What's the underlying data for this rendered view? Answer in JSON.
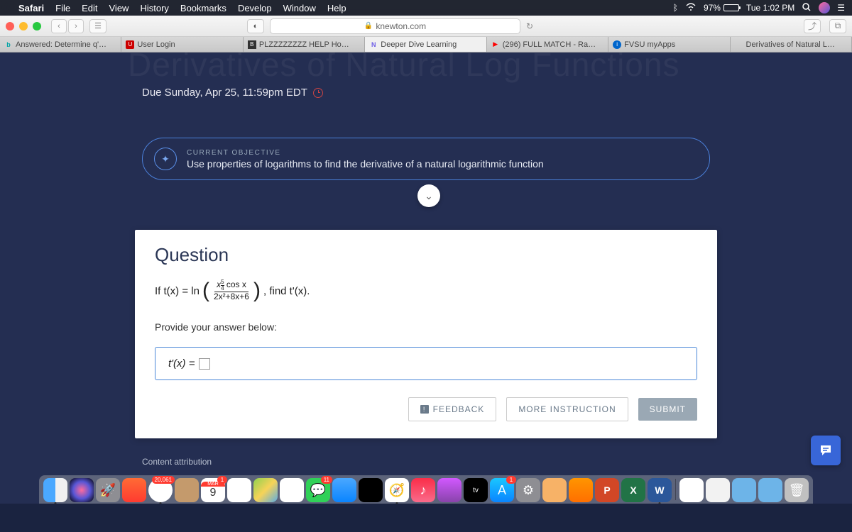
{
  "menubar": {
    "app": "Safari",
    "items": [
      "File",
      "Edit",
      "View",
      "History",
      "Bookmarks",
      "Develop",
      "Window",
      "Help"
    ],
    "battery_pct": "97%",
    "clock": "Tue 1:02 PM"
  },
  "browser": {
    "url_host": "knewton.com"
  },
  "tabs": [
    {
      "label": "Answered: Determine q'…",
      "icon": "b"
    },
    {
      "label": "User Login",
      "icon": "u"
    },
    {
      "label": "PLZZZZZZZZ HELP Ho…",
      "icon": "bb"
    },
    {
      "label": "Deeper Dive Learning",
      "icon": "n",
      "active": true
    },
    {
      "label": "(296) FULL MATCH - Ra…",
      "icon": "yt"
    },
    {
      "label": "FVSU myApps",
      "icon": "i"
    },
    {
      "label": "Derivatives of Natural L…",
      "icon": ""
    }
  ],
  "page": {
    "due_text": "Due Sunday, Apr 25, 11:59pm EDT",
    "objective_label": "CURRENT OBJECTIVE",
    "objective_desc": "Use properties of logarithms to find the derivative of a natural logarithmic function",
    "question_heading": "Question",
    "stmt_prefix": "If t(x) = ln",
    "frac_num_base": "x",
    "frac_num_exp_top": "5",
    "frac_num_exp_bot": "4",
    "frac_num_tail": " cos x",
    "frac_den": "2x²+8x+6",
    "stmt_suffix": ", find t'(x).",
    "provide_label": "Provide your answer below:",
    "answer_prefix": "t'(x) =",
    "feedback_btn": "FEEDBACK",
    "more_btn": "MORE INSTRUCTION",
    "submit_btn": "SUBMIT",
    "attribution": "Content attribution"
  },
  "dock": {
    "chrome_badge": "20,061",
    "mail_badge": "1",
    "cal_month": "MAR",
    "cal_day": "9",
    "msg_badge": "11",
    "store_badge": "1"
  }
}
